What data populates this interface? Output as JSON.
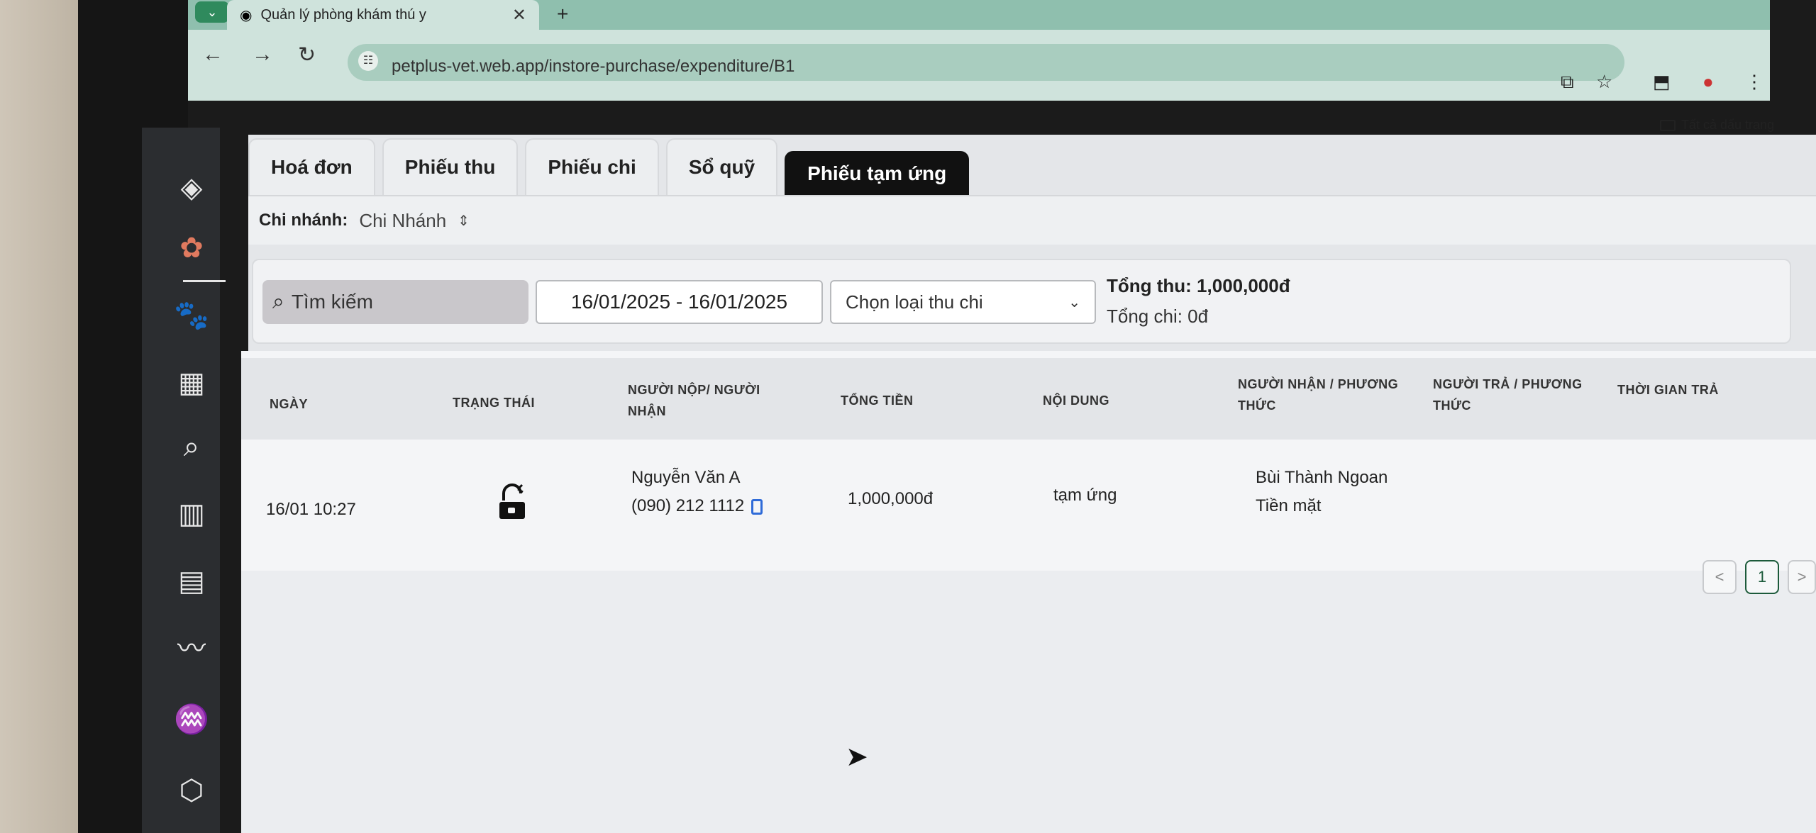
{
  "browser": {
    "tab_title": "Quản lý phòng khám thú y",
    "tab_close": "✕",
    "new_tab": "+",
    "url": "petplus-vet.web.app/instore-purchase/expenditure/B1",
    "bookmarks_label": "Tất cả dấu trang"
  },
  "tabs": [
    "Hoá đơn",
    "Phiếu thu",
    "Phiếu chi",
    "Sổ quỹ",
    "Phiếu tạm ứng"
  ],
  "active_tab": "Phiếu tạm ứng",
  "branch": {
    "label": "Chi nhánh:",
    "value": "Chi Nhánh"
  },
  "filters": {
    "search_placeholder": "Tìm kiếm",
    "date_range": "16/01/2025 - 16/01/2025",
    "type_placeholder": "Chọn loại thu chi"
  },
  "totals": {
    "income": "Tổng thu: 1,000,000đ",
    "expense": "Tổng chi: 0đ"
  },
  "table": {
    "headers": {
      "date": "NGÀY",
      "status": "TRẠNG THÁI",
      "payer_1": "NGƯỜI NỘP/ NGƯỜI",
      "payer_2": "NHẬN",
      "total": "TỔNG TIỀN",
      "content": "NỘI DUNG",
      "receiver_1": "NGƯỜI NHẬN / PHƯƠNG",
      "receiver_2": "THỨC",
      "returner_1": "NGƯỜI TRẢ / PHƯƠNG",
      "returner_2": "THỨC",
      "return_time": "THỜI GIAN TRẢ"
    },
    "rows": [
      {
        "date": "16/01 10:27",
        "payer_name": "Nguyễn Văn A",
        "payer_phone": "(090) 212 1112",
        "total": "1,000,000đ",
        "content": "tạm ứng",
        "receiver_name": "Bùi Thành Ngoan",
        "receiver_method": "Tiền mặt"
      }
    ]
  },
  "pagination": {
    "prev": "<",
    "current": "1",
    "next": ">"
  },
  "colors": {
    "active_tab": "#111111",
    "sidebar": "#2b2d30",
    "browser_chrome": "#cfe3dc",
    "copy_icon": "#2f6bd8"
  }
}
